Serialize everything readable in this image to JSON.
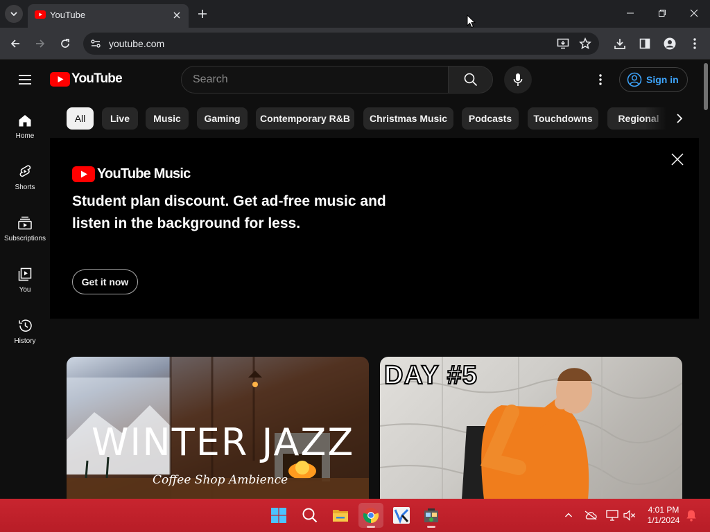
{
  "browser": {
    "tab_title": "YouTube",
    "url": "youtube.com"
  },
  "header": {
    "logo_word": "YouTube",
    "search_placeholder": "Search",
    "sign_in_label": "Sign in"
  },
  "sidebar": {
    "items": [
      {
        "label": "Home",
        "icon": "home-icon"
      },
      {
        "label": "Shorts",
        "icon": "shorts-icon"
      },
      {
        "label": "Subscriptions",
        "icon": "subscriptions-icon"
      },
      {
        "label": "You",
        "icon": "you-icon"
      },
      {
        "label": "History",
        "icon": "history-icon"
      }
    ]
  },
  "chips": [
    "All",
    "Live",
    "Music",
    "Gaming",
    "Contemporary R&B",
    "Christmas Music",
    "Podcasts",
    "Touchdowns",
    "Regional"
  ],
  "banner": {
    "logo_word": "YouTube Music",
    "headline": "Student plan discount. Get ad-free music and listen in the background for less.",
    "cta_label": "Get it now"
  },
  "videos": [
    {
      "thumb_title": "WINTER JAZZ",
      "thumb_subtitle": "Coffee Shop Ambience"
    },
    {
      "thumb_title": "DAY #5"
    }
  ],
  "taskbar": {
    "time": "4:01 PM",
    "date": "1/1/2024"
  },
  "colors": {
    "yt_red": "#ff0000",
    "link_blue": "#3ea6ff",
    "taskbar_red": "#c0222b",
    "page_bg": "#0f0f0f"
  }
}
